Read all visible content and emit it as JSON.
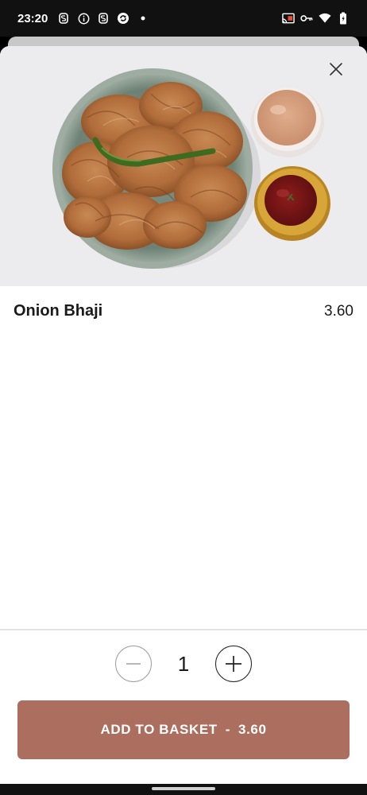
{
  "status_bar": {
    "time": "23:20",
    "left_icons": [
      "s-app-icon",
      "info-icon",
      "s-app-icon",
      "sync-icon",
      "dot-icon"
    ],
    "right_icons": [
      "cast-icon",
      "vpn-key-icon",
      "wifi-icon",
      "battery-icon"
    ]
  },
  "item": {
    "name": "Onion Bhaji",
    "price": "3.60",
    "image_alt": "Plate of onion bhajis with a green chilli, tea and sauce"
  },
  "quantity": {
    "value": "1"
  },
  "add_button": {
    "label": "ADD TO BASKET",
    "separator": "-",
    "price": "3.60"
  },
  "colors": {
    "accent": "#ab6e5f",
    "status_bar": "#111111"
  }
}
